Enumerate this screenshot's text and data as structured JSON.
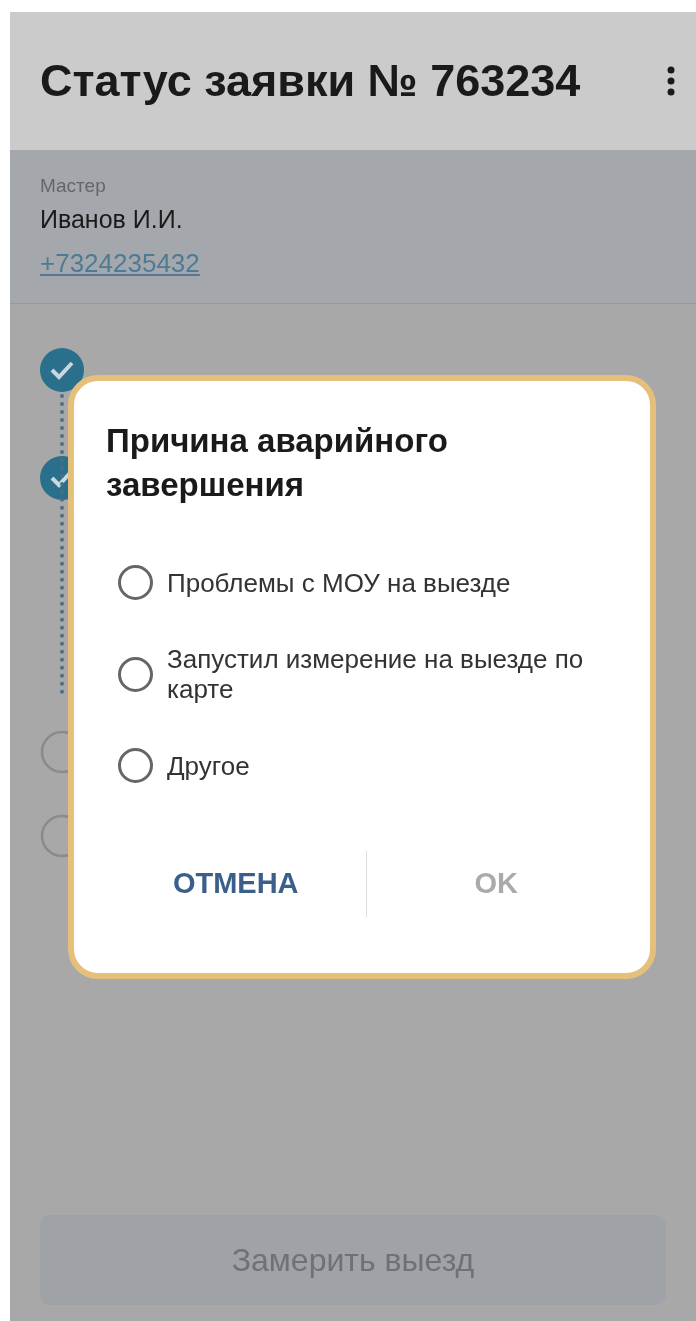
{
  "header": {
    "title": "Статус заявки № 763234"
  },
  "master": {
    "label": "Мастер",
    "name": "Иванов И.И.",
    "phone": "+7324235432"
  },
  "steps": [
    {
      "done": true
    },
    {
      "done": true
    },
    {
      "done": false
    },
    {
      "done": false
    }
  ],
  "dialog": {
    "title": "Причина аварийного завершения",
    "options": [
      {
        "label": "Проблемы с МОУ на выезде",
        "selected": false
      },
      {
        "label": "Запустил измерение на выезде по карте",
        "selected": false
      },
      {
        "label": "Другое",
        "selected": false
      }
    ],
    "cancel": {
      "label": "ОТМЕНА",
      "disabled": false
    },
    "ok": {
      "label": "OK",
      "disabled": true
    }
  },
  "bottom_button": {
    "label": "Замерить выезд",
    "disabled": true
  }
}
